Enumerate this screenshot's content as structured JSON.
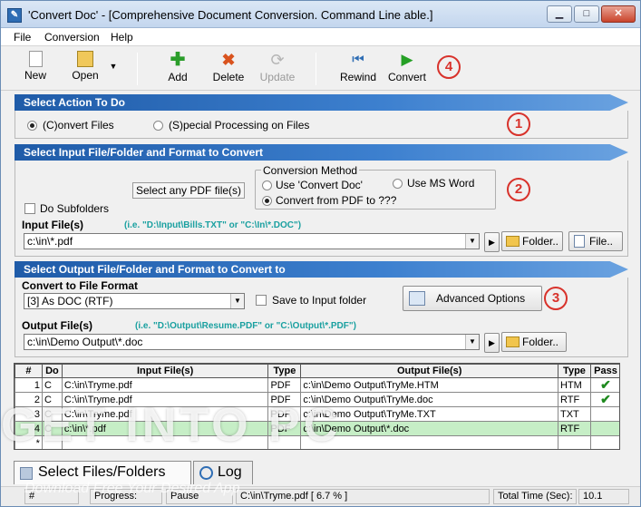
{
  "window": {
    "title": "'Convert Doc' - [Comprehensive Document Conversion. Command Line able.]"
  },
  "menu": [
    "File",
    "Conversion",
    "Help"
  ],
  "toolbar": {
    "new": "New",
    "open": "Open",
    "add": "Add",
    "delete": "Delete",
    "update": "Update",
    "rewind": "Rewind",
    "convert": "Convert"
  },
  "markers": [
    "1",
    "2",
    "3",
    "4"
  ],
  "action": {
    "header": "Select Action To Do",
    "convert_files": "(C)onvert Files",
    "special": "(S)pecial Processing on Files"
  },
  "input": {
    "header": "Select Input File/Folder and Format to Convert",
    "select_pdf": "Select any PDF file(s)",
    "do_subfolders": "Do Subfolders",
    "method_title": "Conversion Method",
    "use_convert_doc": "Use 'Convert Doc'",
    "use_ms_word": "Use MS Word",
    "convert_from_pdf": "Convert from PDF to ???",
    "files_label": "Input File(s)",
    "files_hint": "(i.e. \"D:\\Input\\Bills.TXT\"  or \"C:\\In\\*.DOC\")",
    "files_value": "c:\\in\\*.pdf",
    "folder_button": "Folder..",
    "file_button": "File.."
  },
  "output": {
    "header": "Select Output File/Folder and Format to Convert to",
    "format_label": "Convert to File Format",
    "format_value": "[3] As DOC (RTF)",
    "save_to_input": "Save to Input folder",
    "advanced": "Advanced Options",
    "files_label": "Output File(s)",
    "files_hint": "(i.e. \"D:\\Output\\Resume.PDF\" or \"C:\\Output\\*.PDF\")",
    "files_value": "c:\\in\\Demo Output\\*.doc",
    "folder_button": "Folder.."
  },
  "grid": {
    "columns": [
      "#",
      "Do",
      "Input File(s)",
      "Type",
      "Output File(s)",
      "Type",
      "Pass"
    ],
    "rows": [
      {
        "n": "1",
        "do": "C",
        "input": "C:\\in\\Tryme.pdf",
        "itype": "PDF",
        "output": "c:\\in\\Demo Output\\TryMe.HTM",
        "otype": "HTM",
        "pass": "✔"
      },
      {
        "n": "2",
        "do": "C",
        "input": "C:\\in\\Tryme.pdf",
        "itype": "PDF",
        "output": "c:\\in\\Demo Output\\TryMe.doc",
        "otype": "RTF",
        "pass": "✔"
      },
      {
        "n": "3",
        "do": "C",
        "input": "C:\\in\\Tryme.pdf",
        "itype": "PDF",
        "output": "c:\\in\\Demo Output\\TryMe.TXT",
        "otype": "TXT",
        "pass": ""
      },
      {
        "n": "4",
        "do": "C",
        "input": "c:\\in\\*.pdf",
        "itype": "PDF",
        "output": "c:\\in\\Demo Output\\*.doc",
        "otype": "RTF",
        "pass": ""
      },
      {
        "n": "*",
        "do": "",
        "input": "",
        "itype": "",
        "output": "",
        "otype": "",
        "pass": ""
      }
    ]
  },
  "tabs": {
    "files": "Select Files/Folders",
    "log": "Log"
  },
  "status": {
    "hash": "#",
    "progress": "Progress:",
    "pause": "Pause",
    "current": "C:\\in\\Tryme.pdf [ 6.7 % ]",
    "total_label": "Total Time (Sec):",
    "total_value": "10.1"
  },
  "watermark": {
    "main": "GET INTO PC",
    "sub": "Download Free Your Desired App"
  },
  "colors": {
    "accent": "#2e6db4",
    "marker": "#d8322b",
    "hint": "#1aa0a0",
    "selected_row": "#c6eec6"
  }
}
